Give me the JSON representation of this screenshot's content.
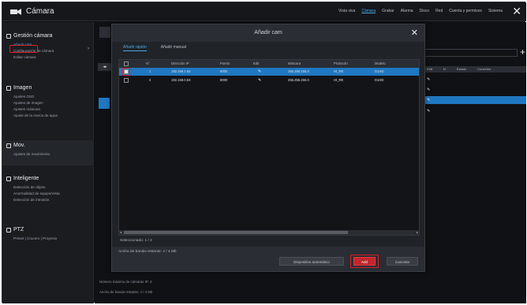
{
  "app": {
    "title": "Cámara"
  },
  "topnav": [
    "Vista viva",
    "Cámara",
    "Grabar",
    "Alarma",
    "Disco",
    "Red",
    "Cuenta y permisos",
    "Sistema"
  ],
  "topnav_active": 1,
  "sidebar": {
    "sections": [
      {
        "title": "Gestión cámara",
        "items": [
          "Añadir cam",
          "Configuración de cámara",
          "Editar cámara"
        ],
        "selected": 0
      },
      {
        "title": "Imagen",
        "items": [
          "Ajustes OSD",
          "Ajustes de imagen",
          "Ajustes máscara",
          "Ajuste de la marca de agua"
        ]
      },
      {
        "title": "Mov.",
        "items": [
          "Ajustes de movimiento"
        ]
      },
      {
        "title": "Inteligente",
        "items": [
          "Detección de objeto",
          "Anormalidad de equipo/Vista",
          "Detección de intrusión"
        ]
      },
      {
        "title": "PTZ",
        "items": [
          "Preset | Crucero | Proyecto"
        ]
      }
    ]
  },
  "background": {
    "info_line1": "Número máximo de cámaras IP: 4",
    "info_line2": "Ancho de banda restante: 4 / 4 Mb",
    "list_headers": [
      "Edit",
      "N",
      "Estado",
      "Conexión"
    ]
  },
  "dialog": {
    "title": "Añadir cam",
    "close": "✕",
    "tabs": [
      "Añadir rápido",
      "Añadir manual"
    ],
    "active_tab": 0,
    "columns": [
      "N°",
      "Dirección IP",
      "Puerto",
      "Edit",
      "Máscara",
      "Protocolo",
      "Modelo"
    ],
    "rows": [
      {
        "no": "1",
        "ip": "192.168.1.63",
        "port": "8000",
        "edit": "✎",
        "mask": "255.255.255.0",
        "protocol": "HI_RE",
        "model": "D1HD",
        "checked": true,
        "selected": true
      },
      {
        "no": "2",
        "ip": "192.168.0.63",
        "port": "8000",
        "edit": "✎",
        "mask": "255.255.255.0",
        "protocol": "HI_RE",
        "model": "D1HD",
        "checked": false,
        "selected": false
      }
    ],
    "selected_count": "Seleccionado: 1 / 2",
    "footer_info": "Ancho de banda restante: 4 / 4 Mb",
    "buttons": {
      "auto": "Dispositivo automático",
      "add": "Add",
      "cancel": "Cancelar"
    }
  },
  "colors": {
    "accent": "#1f78c1",
    "highlight": "#d8222a",
    "link": "#4aa7e6"
  }
}
